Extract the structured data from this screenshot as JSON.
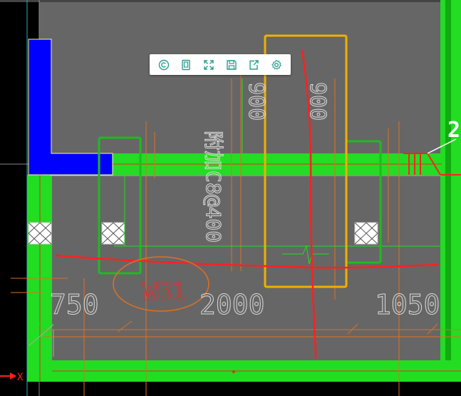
{
  "toolbar": {
    "buttons": [
      {
        "icon": "copyright-icon"
      },
      {
        "icon": "page-icon"
      },
      {
        "icon": "fullscreen-icon"
      },
      {
        "icon": "save-icon"
      },
      {
        "icon": "export-icon"
      },
      {
        "icon": "settings-icon"
      }
    ],
    "accent": "#2a9d8f"
  },
  "drawing": {
    "vertical_dim_1": "900",
    "vertical_dim_2": "900",
    "rebar_note": "附加C8@400",
    "label_wb1": "WB1",
    "dim_left": "750",
    "dim_mid": "2000",
    "dim_right": "1050",
    "edge_label": "2",
    "axis_x_label": "X"
  },
  "colors": {
    "background": "#666666",
    "wall_green": "#22dd22",
    "beam_blue": "#0000ff",
    "highlight_orange": "#f0b000",
    "box_green": "#1faa1f",
    "markup_red": "#ff2020",
    "dim_orange": "#e07020"
  }
}
